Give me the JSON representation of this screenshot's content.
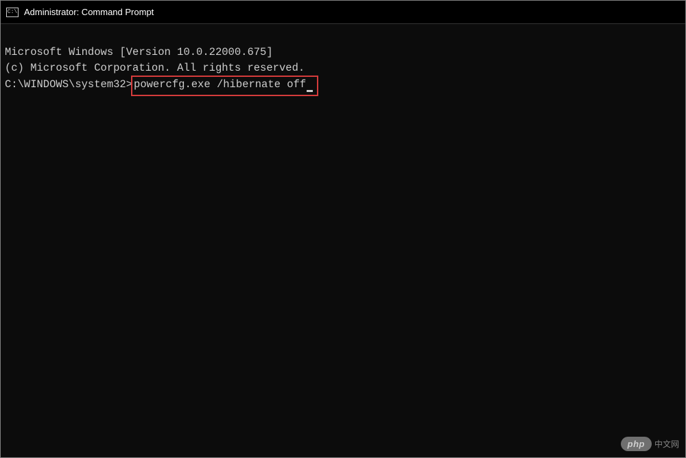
{
  "window": {
    "title": "Administrator: Command Prompt",
    "icon_label": "C:\\"
  },
  "terminal": {
    "line1": "Microsoft Windows [Version 10.0.22000.675]",
    "line2": "(c) Microsoft Corporation. All rights reserved.",
    "blank": "",
    "prompt": "C:\\WINDOWS\\system32>",
    "command": "powercfg.exe /hibernate off"
  },
  "watermark": {
    "badge": "php",
    "text": "中文网"
  }
}
